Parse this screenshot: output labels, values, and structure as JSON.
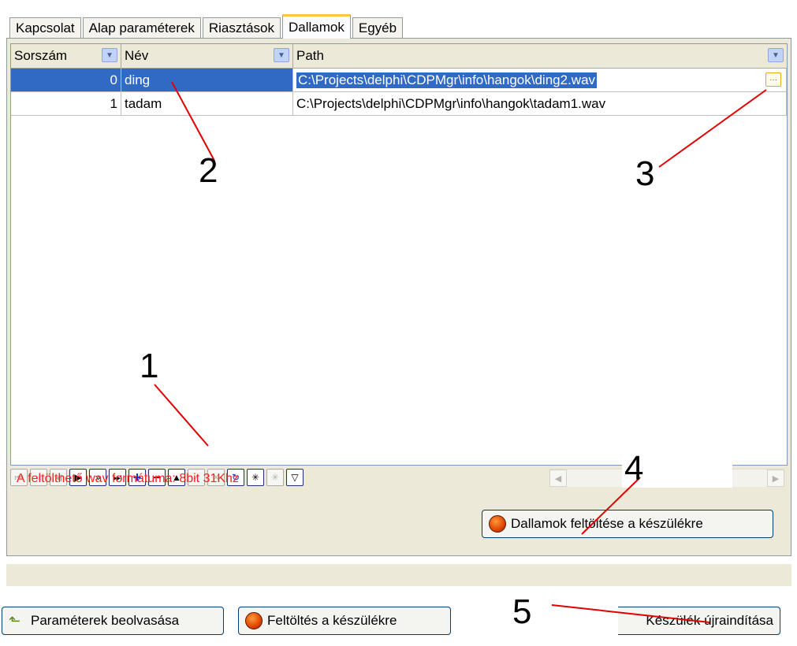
{
  "tabs": [
    {
      "label": "Kapcsolat"
    },
    {
      "label": "Alap paraméterek"
    },
    {
      "label": "Riasztások"
    },
    {
      "label": "Dallamok"
    },
    {
      "label": "Egyéb"
    }
  ],
  "grid": {
    "columns": [
      {
        "label": "Sorszám"
      },
      {
        "label": "Név"
      },
      {
        "label": "Path"
      }
    ],
    "rows": [
      {
        "num": "0",
        "name": "ding",
        "path": "C:\\Projects\\delphi\\CDPMgr\\info\\hangok\\ding2.wav"
      },
      {
        "num": "1",
        "name": "tadam",
        "path": "C:\\Projects\\delphi\\CDPMgr\\info\\hangok\\tadam1.wav"
      }
    ]
  },
  "navigator": {
    "buttons": [
      "first-icon",
      "prior-page-icon",
      "prior-icon",
      "next-icon",
      "next-page-icon",
      "last-icon",
      "insert-icon",
      "delete-icon",
      "edit-icon",
      "post-icon",
      "cancel-icon",
      "refresh-icon",
      "bookmark-icon",
      "goto-bookmark-icon",
      "filter-icon"
    ]
  },
  "info_text": "A feltölthető wav formátuma: 8bit 31Khz",
  "buttons": {
    "upload_melodies": "Dallamok feltöltése a készülékre",
    "read_params": "Paraméterek beolvasása",
    "upload": "Feltöltés a készülékre",
    "restart": "Készülék újraindítása"
  },
  "annotations": [
    "1",
    "2",
    "3",
    "4",
    "5"
  ],
  "colors": {
    "selection": "#316ac5",
    "info": "#ff2020",
    "annotation_line": "#e00000"
  }
}
